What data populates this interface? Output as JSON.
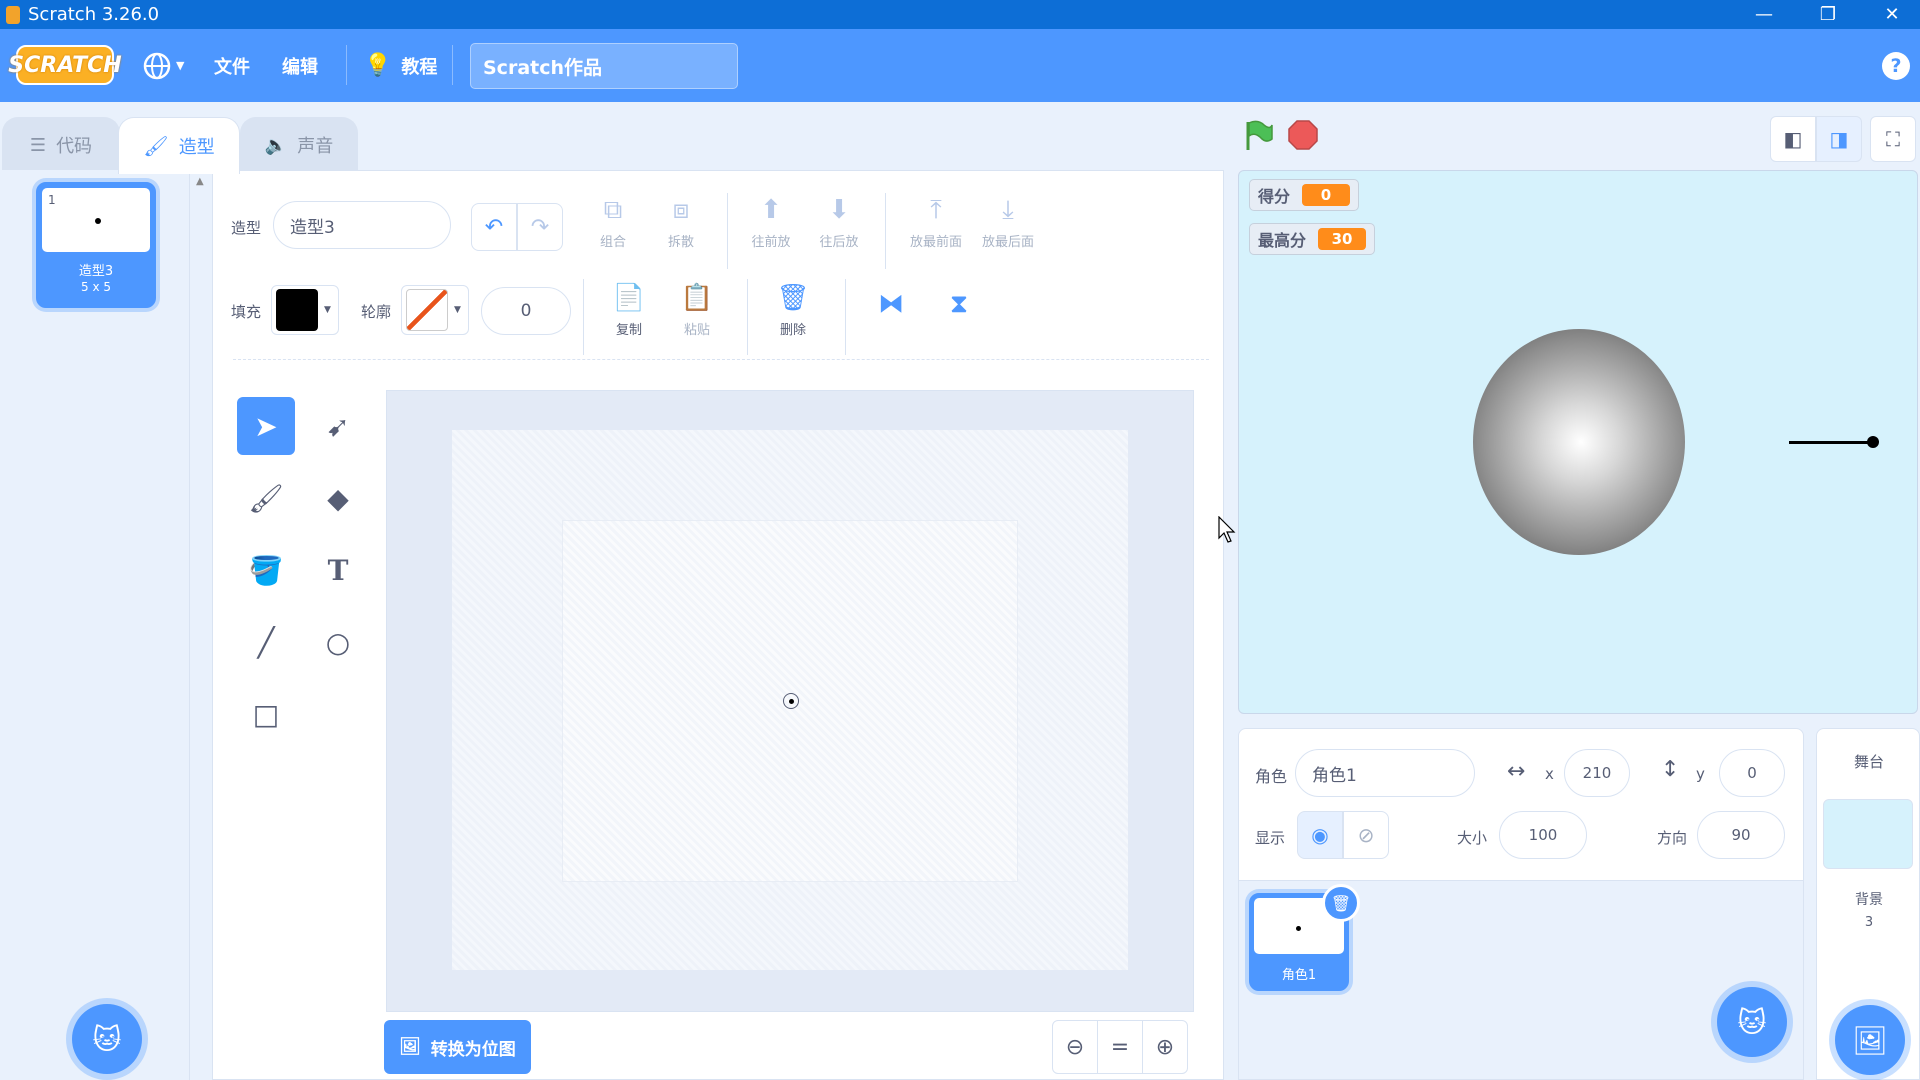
{
  "window": {
    "title": "Scratch 3.26.0",
    "minimize": "—",
    "restore": "❐",
    "close": "✕"
  },
  "menubar": {
    "logo": "SCRATCH",
    "language_icon": "globe-icon",
    "file": "文件",
    "edit": "编辑",
    "tutorials": "教程",
    "project_title": "Scratch作品",
    "help": "?"
  },
  "tabs": {
    "code": "代码",
    "costumes": "造型",
    "sounds": "声音"
  },
  "costume_list": [
    {
      "number": "1",
      "name": "造型3",
      "size": "5 x 5"
    }
  ],
  "editor": {
    "costume_label": "造型",
    "costume_name": "造型3",
    "fill_label": "填充",
    "outline_label": "轮廓",
    "outline_width": "0",
    "toolbar": {
      "group": "组合",
      "ungroup": "拆散",
      "forward": "往前放",
      "backward": "往后放",
      "front": "放最前面",
      "back": "放最后面",
      "copy": "复制",
      "paste": "粘贴",
      "delete": "删除"
    },
    "convert_bitmap": "转换为位图",
    "fill_color": "#000000",
    "tools": [
      "select-icon",
      "reshape-icon",
      "brush-icon",
      "eraser-icon",
      "fill-icon",
      "text-icon",
      "line-icon",
      "circle-icon",
      "rectangle-icon"
    ]
  },
  "stage": {
    "monitors": [
      {
        "label": "得分",
        "value": "0"
      },
      {
        "label": "最高分",
        "value": "30"
      }
    ],
    "background": "#d6f2fc"
  },
  "sprite_info": {
    "sprite_label": "角色",
    "sprite_name": "角色1",
    "x_label": "x",
    "x": "210",
    "y_label": "y",
    "y": "0",
    "show_label": "显示",
    "size_label": "大小",
    "size": "100",
    "direction_label": "方向",
    "direction": "90"
  },
  "sprites": [
    {
      "name": "角色1"
    }
  ],
  "stage_pane": {
    "title": "舞台",
    "backdrops_label": "背景",
    "backdrops_count": "3"
  },
  "colors": {
    "accent": "#4d97ff",
    "titlebar": "#0d6ed6",
    "monitor_value": "#ff8c1a"
  }
}
